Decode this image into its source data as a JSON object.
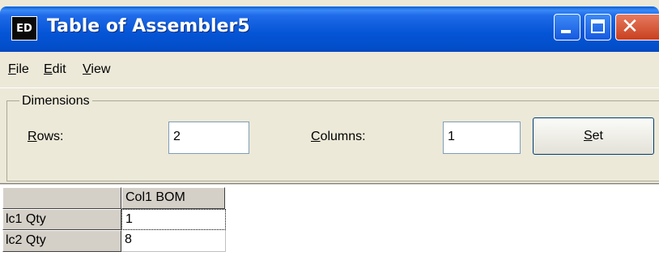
{
  "window": {
    "title": "Table of Assembler5",
    "app_icon_text": "ED",
    "close_glyph": "✕"
  },
  "menu": {
    "file_mnemonic": "F",
    "file_rest": "ile",
    "edit_mnemonic": "E",
    "edit_rest": "dit",
    "view_mnemonic": "V",
    "view_rest": "iew"
  },
  "dimensions": {
    "group_label": "Dimensions",
    "rows_mnemonic": "R",
    "rows_rest": "ows:",
    "rows_value": "2",
    "columns_mnemonic": "C",
    "columns_rest": "olumns:",
    "columns_value": "1",
    "set_mnemonic": "S",
    "set_rest": "et"
  },
  "table": {
    "column_header": "Col1 BOM",
    "rows": [
      {
        "header": "lc1 Qty",
        "value": "1"
      },
      {
        "header": "lc2 Qty",
        "value": "8"
      }
    ]
  },
  "colors": {
    "titlebar": "#0454d6",
    "window_bg": "#ece9d8",
    "close_button": "#c8401f"
  }
}
